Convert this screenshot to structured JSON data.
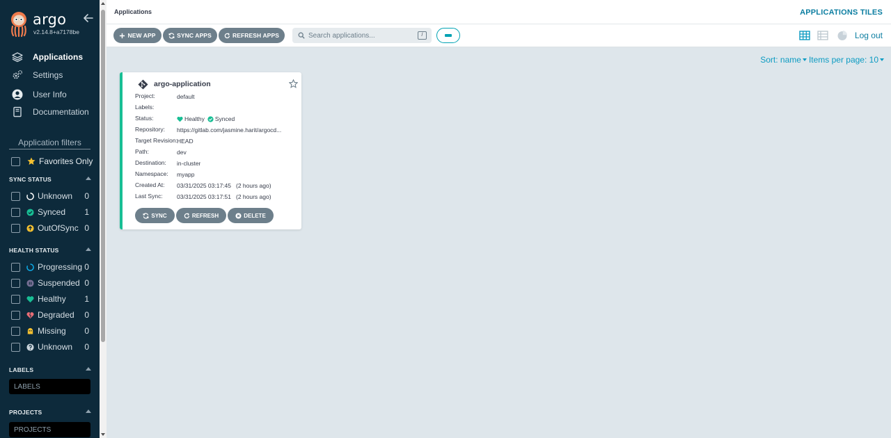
{
  "brand": {
    "name": "argo",
    "version": "v2.14.8+a7178be"
  },
  "nav": [
    {
      "label": "Applications",
      "icon": "layers-icon",
      "active": true
    },
    {
      "label": "Settings",
      "icon": "gears-icon"
    },
    {
      "label": "User Info",
      "icon": "user-circle-icon"
    },
    {
      "label": "Documentation",
      "icon": "book-icon"
    }
  ],
  "filters": {
    "title": "Application filters",
    "favorites_label": "Favorites Only",
    "sync_status": {
      "heading": "SYNC STATUS",
      "items": [
        {
          "label": "Unknown",
          "count": "0",
          "icon": "circle-notch-icon",
          "color": "#ffffff"
        },
        {
          "label": "Synced",
          "count": "1",
          "icon": "check-circle-icon",
          "color": "#18be94"
        },
        {
          "label": "OutOfSync",
          "count": "0",
          "icon": "arrow-circle-up-icon",
          "color": "#f4c030"
        }
      ]
    },
    "health_status": {
      "heading": "HEALTH STATUS",
      "items": [
        {
          "label": "Progressing",
          "count": "0",
          "icon": "circle-notch-icon",
          "color": "#0dadea"
        },
        {
          "label": "Suspended",
          "count": "0",
          "icon": "pause-circle-icon",
          "color": "#766f94"
        },
        {
          "label": "Healthy",
          "count": "1",
          "icon": "heart-icon",
          "color": "#18be94"
        },
        {
          "label": "Degraded",
          "count": "0",
          "icon": "heart-broken-icon",
          "color": "#e96d76"
        },
        {
          "label": "Missing",
          "count": "0",
          "icon": "ghost-icon",
          "color": "#f4c030"
        },
        {
          "label": "Unknown",
          "count": "0",
          "icon": "question-circle-icon",
          "color": "#ccd6dd"
        }
      ]
    },
    "labels": {
      "heading": "LABELS",
      "placeholder": "LABELS"
    },
    "projects": {
      "heading": "PROJECTS",
      "placeholder": "PROJECTS"
    }
  },
  "topbar": {
    "breadcrumb": "Applications",
    "view_title": "APPLICATIONS TILES",
    "logout": "Log out"
  },
  "toolbar": {
    "new_app": "NEW APP",
    "sync_apps": "SYNC APPS",
    "refresh_apps": "REFRESH APPS",
    "search_placeholder": "Search applications...",
    "search_shortcut": "/"
  },
  "sort": {
    "sort_label": "Sort: name",
    "per_page_label": "Items per page: 10"
  },
  "app": {
    "name": "argo-application",
    "rows": [
      {
        "key": "Project:",
        "value": "default"
      },
      {
        "key": "Labels:",
        "value": ""
      },
      {
        "key": "Status:",
        "health": "Healthy",
        "sync": "Synced"
      },
      {
        "key": "Repository:",
        "value": "https://gitlab.com/jasmine.harit/argocd..."
      },
      {
        "key": "Target Revision:",
        "value": "HEAD"
      },
      {
        "key": "Path:",
        "value": "dev"
      },
      {
        "key": "Destination:",
        "value": "in-cluster"
      },
      {
        "key": "Namespace:",
        "value": "myapp"
      },
      {
        "key": "Created At:",
        "value": "03/31/2025 03:17:45",
        "sub": "(2 hours ago)"
      },
      {
        "key": "Last Sync:",
        "value": "03/31/2025 03:17:51",
        "sub": "(2 hours ago)"
      }
    ],
    "actions": {
      "sync": "SYNC",
      "refresh": "REFRESH",
      "delete": "DELETE"
    }
  },
  "colors": {
    "sidebar_bg": "#0d2a3b",
    "accent": "#0c7ea1",
    "healthy": "#18be94",
    "button": "#6d7f8b"
  }
}
